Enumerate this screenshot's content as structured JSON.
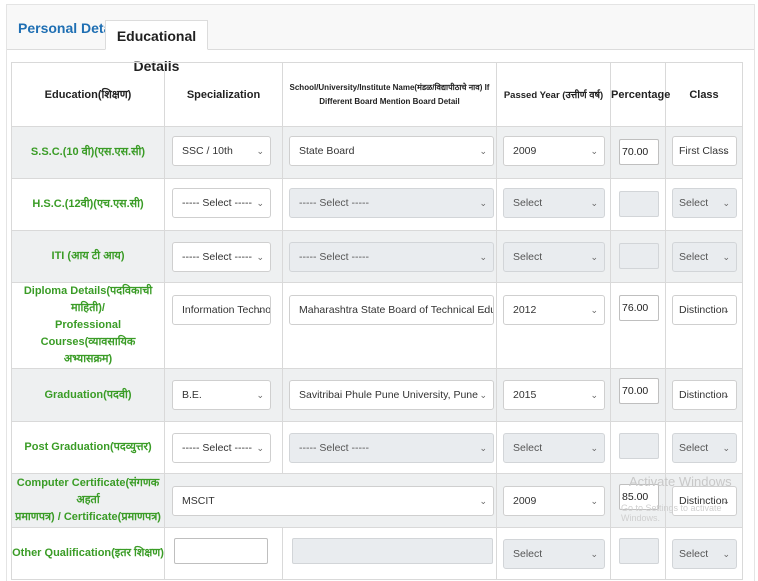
{
  "tabs": {
    "personal": "Personal Details",
    "educational": "Educational Details"
  },
  "headers": {
    "education": "Education(शिक्षण)",
    "specialization": "Specialization",
    "school_line1": "School/University/Institute Name(मंडळ/विद्यापीठाचे नाव) If",
    "school_line2": "Different Board Mention Board Detail",
    "passed_year": "Passed Year (उत्तीर्ण वर्ष)",
    "percentage": "Percentage",
    "class": "Class"
  },
  "rows": [
    {
      "label": [
        "S.S.C.(10 वी)(एस.एस.सी)"
      ],
      "specialization": "SSC / 10th",
      "school": "State Board",
      "year": "2009",
      "percentage": "70.00",
      "class": "First Class"
    },
    {
      "label": [
        "H.S.C.(12वी)(एच.एस.सी)"
      ],
      "specialization": "----- Select -----",
      "school": "----- Select -----",
      "year": "Select",
      "percentage": "",
      "class": "Select"
    },
    {
      "label": [
        "ITI (आय टी आय)"
      ],
      "specialization": "----- Select -----",
      "school": "----- Select -----",
      "year": "Select",
      "percentage": "",
      "class": "Select"
    },
    {
      "label": [
        "Diploma Details(पदविकाची माहिती)/",
        "Professional Courses(व्यावसायिक",
        "अभ्यासक्रम)"
      ],
      "specialization": "Information Technolo",
      "school": "Maharashtra State Board of Technical Education",
      "year": "2012",
      "percentage": "76.00",
      "class": "Distinction"
    },
    {
      "label": [
        "Graduation(पदवी)"
      ],
      "specialization": "B.E.",
      "school": "Savitribai Phule Pune University, Pune",
      "year": "2015",
      "percentage": "70.00",
      "class": "Distinction"
    },
    {
      "label": [
        "Post Graduation(पदव्युत्तर)"
      ],
      "specialization": "----- Select -----",
      "school": "----- Select -----",
      "year": "Select",
      "percentage": "",
      "class": "Select"
    },
    {
      "label": [
        "Computer Certificate(संगणक अहर्ता",
        "प्रमाणपत्र) / Certificate(प्रमाणपत्र)"
      ],
      "certificate": "MSCIT",
      "year": "2009",
      "percentage": "85.00",
      "class": "Distinction"
    },
    {
      "label": [
        "Other Qualification(इतर शिक्षण)"
      ],
      "specialization": "",
      "school": "",
      "year": "Select",
      "percentage": "",
      "class": "Select"
    }
  ],
  "watermark": {
    "line1": "Activate Windows",
    "line2": "Go to Settings to activate Windows."
  },
  "icons": {
    "dropdown": "chevron-down-icon"
  },
  "colors": {
    "tab_active": "#1f6fb3",
    "label_green": "#3a9c26",
    "row_shade": "#eef0f1"
  }
}
